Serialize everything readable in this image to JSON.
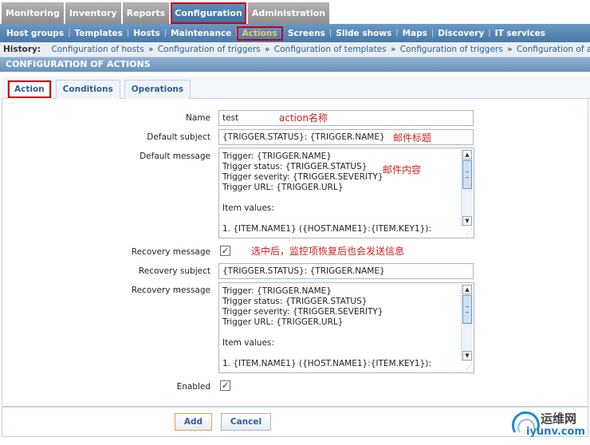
{
  "top_nav": [
    "Monitoring",
    "Inventory",
    "Reports",
    "Configuration",
    "Administration"
  ],
  "sub_nav": [
    "Host groups",
    "Templates",
    "Hosts",
    "Maintenance",
    "Actions",
    "Screens",
    "Slide shows",
    "Maps",
    "Discovery",
    "IT services"
  ],
  "history": {
    "label": "History:",
    "crumbs": [
      "Configuration of hosts",
      "Configuration of triggers",
      "Configuration of templates",
      "Configuration of triggers",
      "Configuration of actions"
    ],
    "separator": "»"
  },
  "section_title": "CONFIGURATION OF ACTIONS",
  "form_tabs": [
    "Action",
    "Conditions",
    "Operations"
  ],
  "form": {
    "name_label": "Name",
    "name_value": "test",
    "default_subject_label": "Default subject",
    "default_subject_value": "{TRIGGER.STATUS}: {TRIGGER.NAME}",
    "default_message_label": "Default message",
    "default_message_lines": [
      "Trigger: {TRIGGER.NAME}",
      "Trigger status: {TRIGGER.STATUS}",
      "Trigger severity: {TRIGGER.SEVERITY}",
      "Trigger URL: {TRIGGER.URL}",
      "",
      "Item values:",
      "",
      "1. {ITEM.NAME1} ({HOST.NAME1}:{ITEM.KEY1}):"
    ],
    "recovery_message_label": "Recovery message",
    "recovery_checked": "✓",
    "recovery_subject_label": "Recovery subject",
    "recovery_subject_value": "{TRIGGER.STATUS}: {TRIGGER.NAME}",
    "recovery_body_label": "Recovery message",
    "recovery_message_lines": [
      "Trigger: {TRIGGER.NAME}",
      "Trigger status: {TRIGGER.STATUS}",
      "Trigger severity: {TRIGGER.SEVERITY}",
      "Trigger URL: {TRIGGER.URL}",
      "",
      "Item values:",
      "",
      "1. {ITEM.NAME1} ({HOST.NAME1}:{ITEM.KEY1}):"
    ],
    "enabled_label": "Enabled",
    "enabled_checked": "✓"
  },
  "annotations": {
    "name_note": "action名称",
    "subject_note": "邮件标题",
    "message_note": "邮件内容",
    "recovery_note": "选中后，监控项恢复后也会发送信息"
  },
  "buttons": {
    "add": "Add",
    "cancel": "Cancel"
  },
  "watermark": {
    "line1": "运维网",
    "line2": "iyunv.com"
  },
  "colors": {
    "accent": "#cc0000",
    "nav_blue": "#4a79a8",
    "active_subnav": "#f2c94c"
  }
}
